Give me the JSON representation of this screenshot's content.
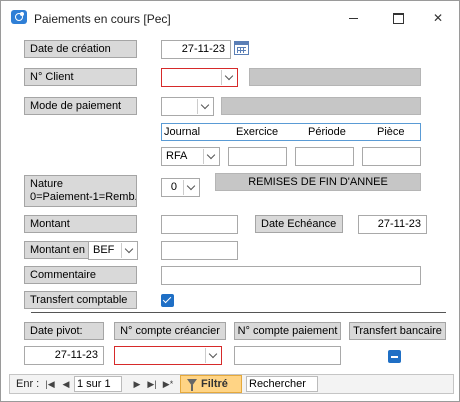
{
  "window": {
    "title": "Paiements en cours [Pec]"
  },
  "form": {
    "date_creation": {
      "label": "Date de création",
      "value": "27-11-23"
    },
    "client": {
      "label": "N° Client",
      "value": ""
    },
    "mode_paiement": {
      "label": "Mode de paiement",
      "value": ""
    },
    "journal_headers": {
      "journal": "Journal",
      "exercice": "Exercice",
      "periode": "Période",
      "piece": "Pièce"
    },
    "journal_values": {
      "journal": "RFA",
      "exercice": "",
      "periode": "",
      "piece": ""
    },
    "nature": {
      "label_line1": "Nature",
      "label_line2": "0=Paiement-1=Remb.",
      "value": "0"
    },
    "nature_description": "REMISES DE FIN D'ANNEE",
    "montant": {
      "label": "Montant",
      "value": ""
    },
    "date_echeance": {
      "label": "Date Echéance",
      "value": "27-11-23"
    },
    "montant_en": {
      "label": "Montant en",
      "currency": "BEF",
      "value": ""
    },
    "commentaire": {
      "label": "Commentaire",
      "value": ""
    },
    "transfert_comptable": {
      "label": "Transfert comptable",
      "checked": true
    }
  },
  "bottom": {
    "date_pivot": {
      "label": "Date pivot:",
      "value": "27-11-23"
    },
    "compte_creancier": {
      "label": "N° compte créancier",
      "value": ""
    },
    "compte_paiement": {
      "label": "N° compte paiement",
      "value": ""
    },
    "transfert_bancaire": {
      "label": "Transfert bancaire",
      "state": "indeterminate"
    }
  },
  "navbar": {
    "record_label": "Enr :",
    "record_value": "1 sur 1",
    "filter_label": "Filtré",
    "search_label": "Rechercher"
  },
  "colors": {
    "accent": "#1f6fc5",
    "label_bg": "#d9d9d9",
    "invalid_border": "#d62a2a",
    "filter_bg": "#ffd485"
  }
}
